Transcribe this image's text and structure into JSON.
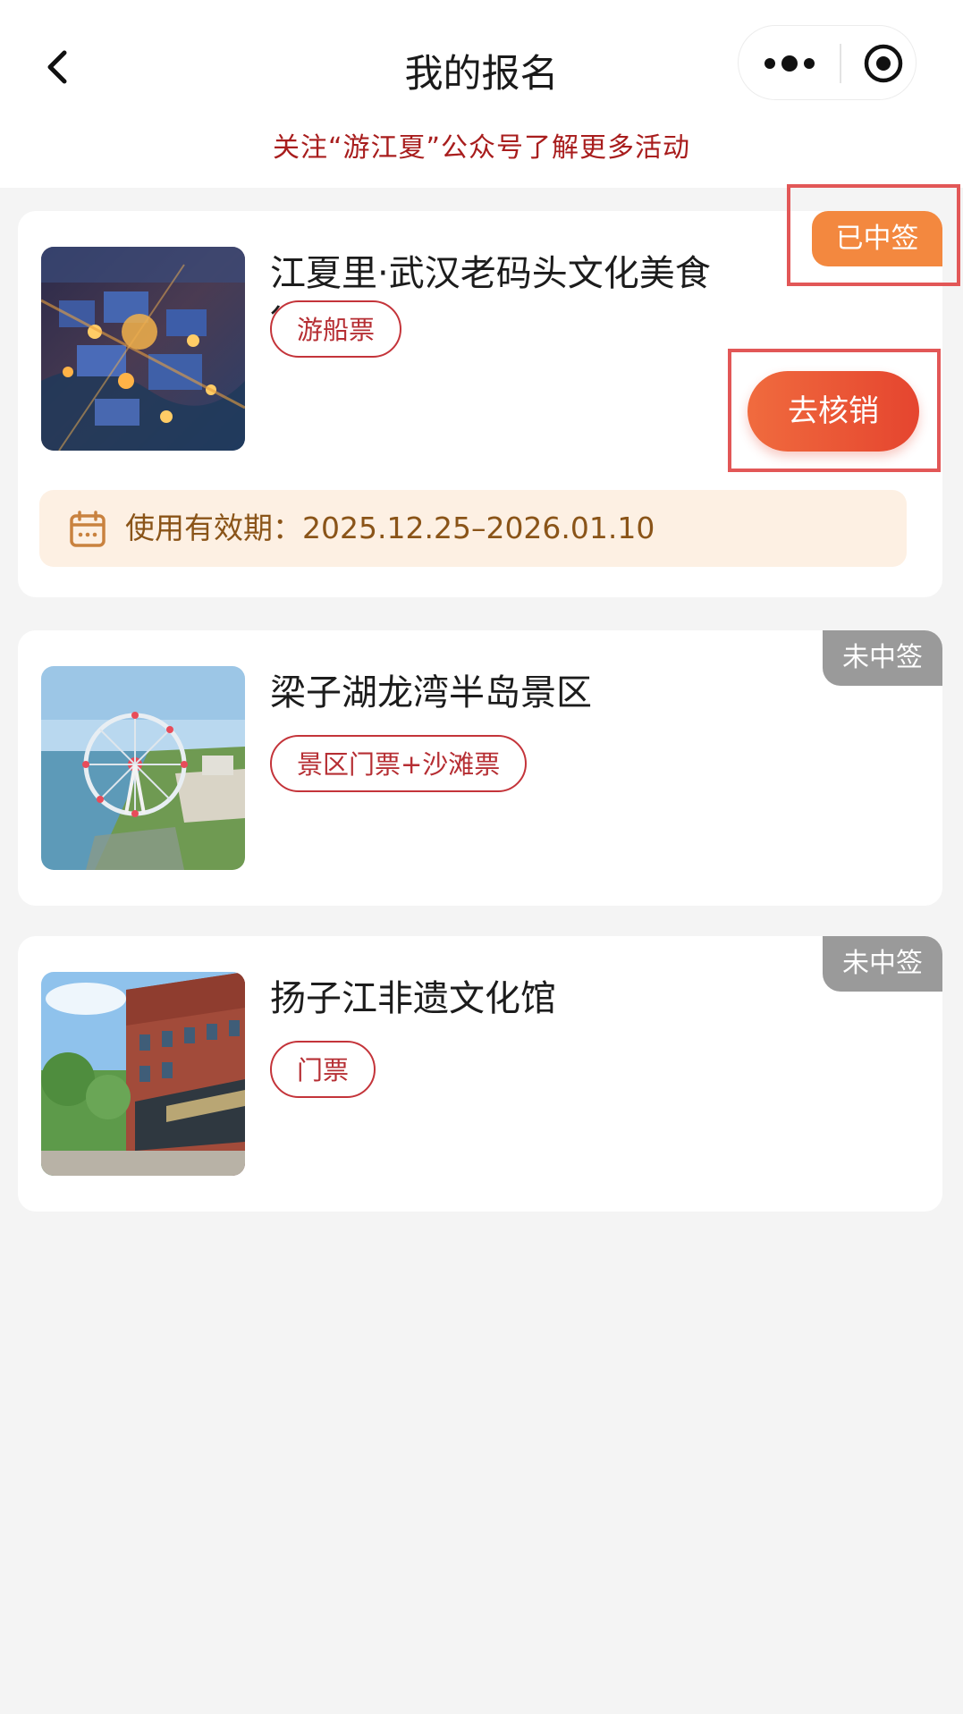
{
  "header": {
    "title": "我的报名",
    "notice": "关注“游江夏”公众号了解更多活动"
  },
  "icons": {
    "back": "chevron-left-icon",
    "more": "more-dots-icon",
    "close": "target-circle-icon",
    "calendar": "calendar-icon"
  },
  "colors": {
    "accent": "#e5452f",
    "tag": "#c4343a",
    "won_badge": "#f3883f",
    "lost_badge": "#9a9a9a",
    "validity_bg": "#fdf0e3"
  },
  "registrations": [
    {
      "title": "江夏里·武汉老码头文化美食街区",
      "tag": "游船票",
      "status": "已中签",
      "action": "去核销",
      "validity_label": "使用有效期：",
      "validity_range": "2025.12.25–2026.01.10"
    },
    {
      "title": "梁子湖龙湾半岛景区",
      "tag": "景区门票+沙滩票",
      "status": "未中签"
    },
    {
      "title": "扬子江非遗文化馆",
      "tag": "门票",
      "status": "未中签"
    }
  ]
}
